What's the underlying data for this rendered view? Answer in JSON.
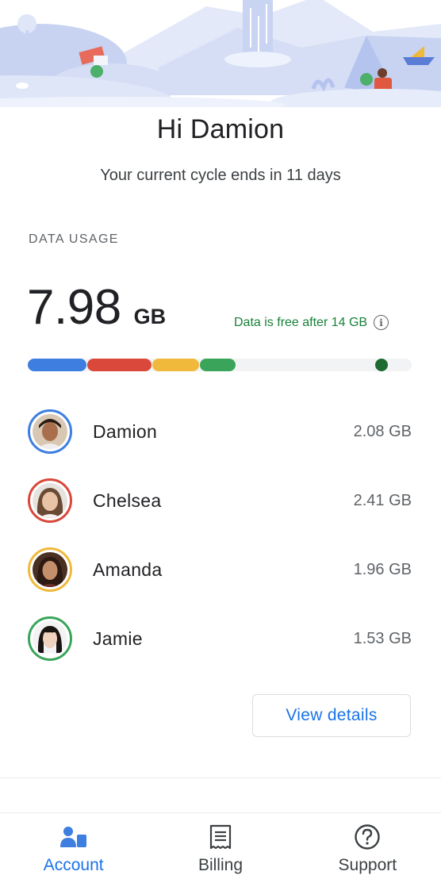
{
  "greeting": "Hi Damion",
  "cycle_text": "Your current cycle ends in 11 days",
  "data_usage": {
    "section_label": "DATA USAGE",
    "amount": "7.98",
    "unit": "GB",
    "free_note": "Data is free after 14 GB",
    "info_icon": "info-icon",
    "bar": {
      "segments": [
        {
          "member": "Damion",
          "color": "#3d7ee0",
          "gb": 2.08
        },
        {
          "member": "Chelsea",
          "color": "#d9483b",
          "gb": 2.41
        },
        {
          "member": "Amanda",
          "color": "#f0b93c",
          "gb": 1.96
        },
        {
          "member": "Jamie",
          "color": "#3aa55a",
          "gb": 1.53
        }
      ],
      "limit_marker_color": "#1e6b32"
    }
  },
  "members": [
    {
      "name": "Damion",
      "usage": "2.08 GB",
      "ring_color": "#3d7ee0"
    },
    {
      "name": "Chelsea",
      "usage": "2.41 GB",
      "ring_color": "#d9483b"
    },
    {
      "name": "Amanda",
      "usage": "1.96 GB",
      "ring_color": "#f0b93c"
    },
    {
      "name": "Jamie",
      "usage": "1.53 GB",
      "ring_color": "#3aa55a"
    }
  ],
  "view_details_label": "View details",
  "bottom_nav": [
    {
      "label": "Account",
      "icon": "account-icon",
      "active": true
    },
    {
      "label": "Billing",
      "icon": "billing-icon",
      "active": false
    },
    {
      "label": "Support",
      "icon": "support-icon",
      "active": false
    }
  ],
  "colors": {
    "accent": "#1a73e8",
    "free_note": "#188038"
  }
}
